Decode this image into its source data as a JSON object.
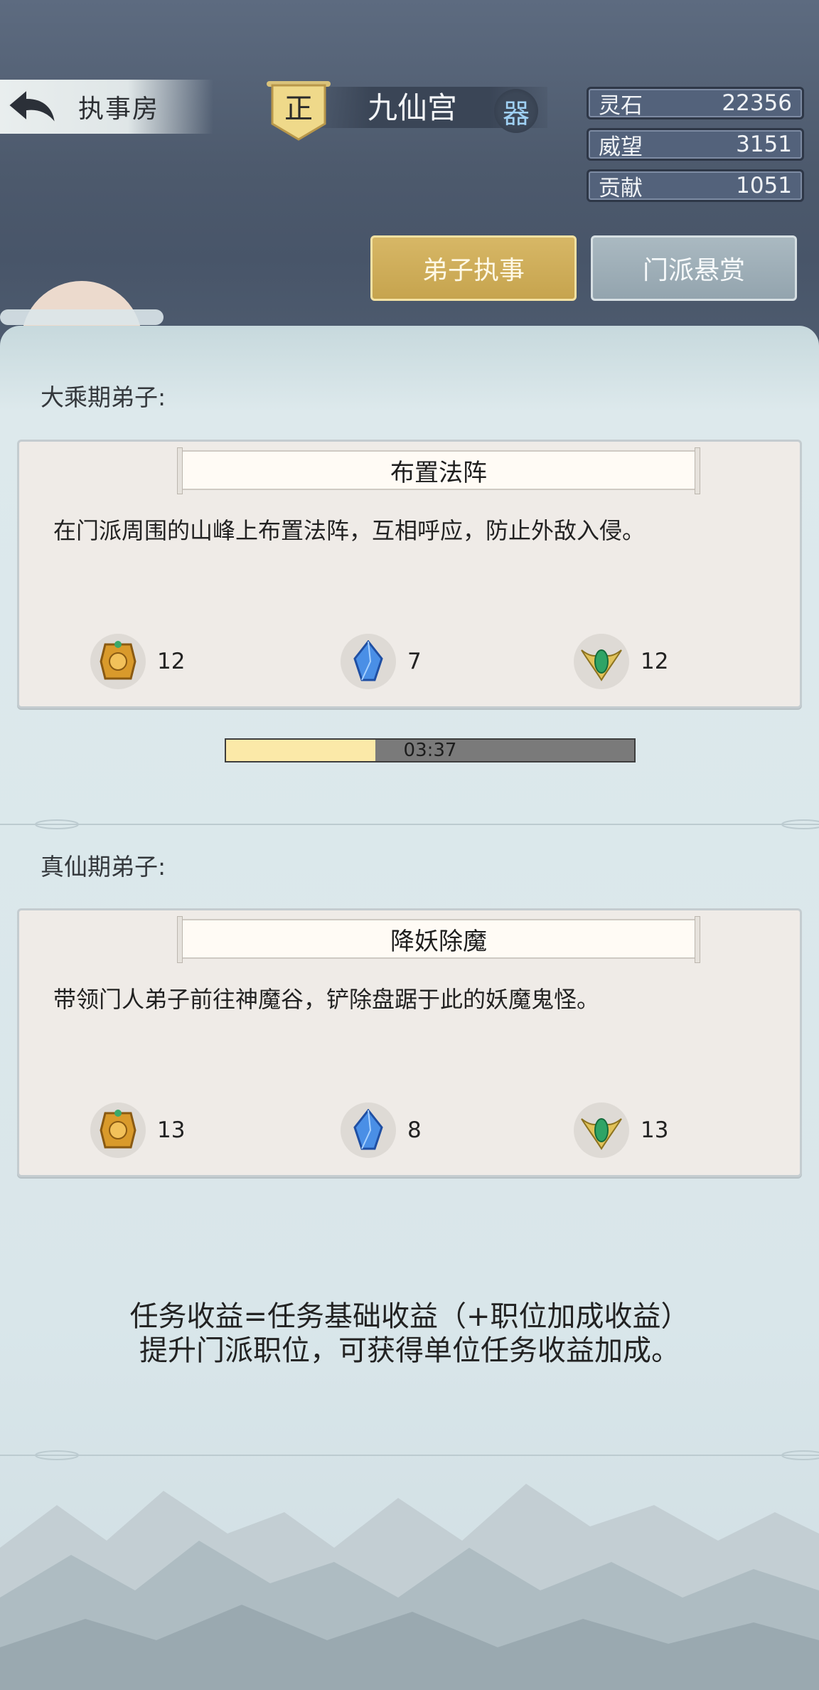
{
  "header": {
    "back_label": "执事房",
    "banner_char": "正",
    "sect_name": "九仙宫",
    "badge_char": "器"
  },
  "resources": [
    {
      "label": "灵石",
      "value": "22356"
    },
    {
      "label": "威望",
      "value": "3151"
    },
    {
      "label": "贡献",
      "value": "1051"
    }
  ],
  "tabs": [
    {
      "label": "弟子执事",
      "active": true
    },
    {
      "label": "门派悬赏",
      "active": false
    }
  ],
  "sections": [
    {
      "label": "大乘期弟子:",
      "task_title": "布置法阵",
      "task_desc": "在门派周围的山峰上布置法阵，互相呼应，防止外敌入侵。",
      "rewards": [
        {
          "icon": "gold-token-icon",
          "value": "12"
        },
        {
          "icon": "blue-crystal-icon",
          "value": "7"
        },
        {
          "icon": "jade-emblem-icon",
          "value": "12"
        }
      ],
      "timer": {
        "text": "03:37",
        "progress": 0.365
      }
    },
    {
      "label": "真仙期弟子:",
      "task_title": "降妖除魔",
      "task_desc": "带领门人弟子前往神魔谷，铲除盘踞于此的妖魔鬼怪。",
      "rewards": [
        {
          "icon": "gold-token-icon",
          "value": "13"
        },
        {
          "icon": "blue-crystal-icon",
          "value": "8"
        },
        {
          "icon": "jade-emblem-icon",
          "value": "13"
        }
      ]
    }
  ],
  "footer": {
    "line1": "任务收益=任务基础收益（+职位加成收益）",
    "line2": "提升门派职位，可获得单位任务收益加成。"
  },
  "colors": {
    "active_tab": "#c9a752",
    "inactive_tab": "#9aaab4",
    "progress_fill": "#fbe9a8"
  }
}
